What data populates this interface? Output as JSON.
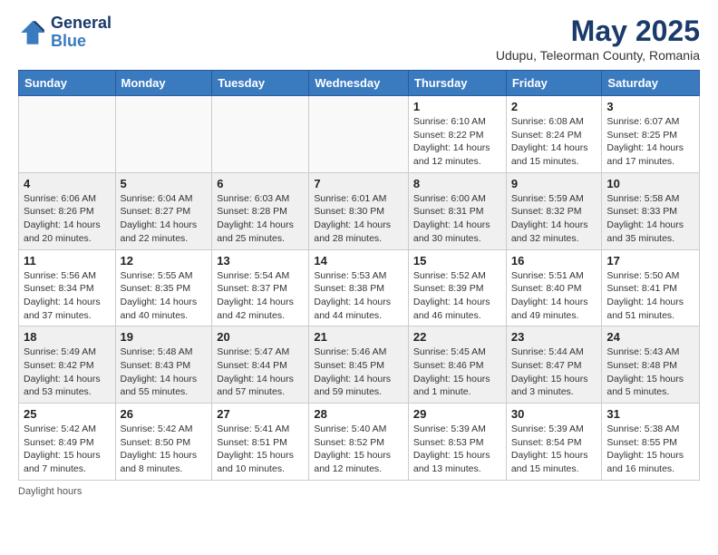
{
  "header": {
    "logo_line1": "General",
    "logo_line2": "Blue",
    "month": "May 2025",
    "location": "Udupu, Teleorman County, Romania"
  },
  "weekdays": [
    "Sunday",
    "Monday",
    "Tuesday",
    "Wednesday",
    "Thursday",
    "Friday",
    "Saturday"
  ],
  "weeks": [
    [
      {
        "day": "",
        "info": ""
      },
      {
        "day": "",
        "info": ""
      },
      {
        "day": "",
        "info": ""
      },
      {
        "day": "",
        "info": ""
      },
      {
        "day": "1",
        "info": "Sunrise: 6:10 AM\nSunset: 8:22 PM\nDaylight: 14 hours\nand 12 minutes."
      },
      {
        "day": "2",
        "info": "Sunrise: 6:08 AM\nSunset: 8:24 PM\nDaylight: 14 hours\nand 15 minutes."
      },
      {
        "day": "3",
        "info": "Sunrise: 6:07 AM\nSunset: 8:25 PM\nDaylight: 14 hours\nand 17 minutes."
      }
    ],
    [
      {
        "day": "4",
        "info": "Sunrise: 6:06 AM\nSunset: 8:26 PM\nDaylight: 14 hours\nand 20 minutes."
      },
      {
        "day": "5",
        "info": "Sunrise: 6:04 AM\nSunset: 8:27 PM\nDaylight: 14 hours\nand 22 minutes."
      },
      {
        "day": "6",
        "info": "Sunrise: 6:03 AM\nSunset: 8:28 PM\nDaylight: 14 hours\nand 25 minutes."
      },
      {
        "day": "7",
        "info": "Sunrise: 6:01 AM\nSunset: 8:30 PM\nDaylight: 14 hours\nand 28 minutes."
      },
      {
        "day": "8",
        "info": "Sunrise: 6:00 AM\nSunset: 8:31 PM\nDaylight: 14 hours\nand 30 minutes."
      },
      {
        "day": "9",
        "info": "Sunrise: 5:59 AM\nSunset: 8:32 PM\nDaylight: 14 hours\nand 32 minutes."
      },
      {
        "day": "10",
        "info": "Sunrise: 5:58 AM\nSunset: 8:33 PM\nDaylight: 14 hours\nand 35 minutes."
      }
    ],
    [
      {
        "day": "11",
        "info": "Sunrise: 5:56 AM\nSunset: 8:34 PM\nDaylight: 14 hours\nand 37 minutes."
      },
      {
        "day": "12",
        "info": "Sunrise: 5:55 AM\nSunset: 8:35 PM\nDaylight: 14 hours\nand 40 minutes."
      },
      {
        "day": "13",
        "info": "Sunrise: 5:54 AM\nSunset: 8:37 PM\nDaylight: 14 hours\nand 42 minutes."
      },
      {
        "day": "14",
        "info": "Sunrise: 5:53 AM\nSunset: 8:38 PM\nDaylight: 14 hours\nand 44 minutes."
      },
      {
        "day": "15",
        "info": "Sunrise: 5:52 AM\nSunset: 8:39 PM\nDaylight: 14 hours\nand 46 minutes."
      },
      {
        "day": "16",
        "info": "Sunrise: 5:51 AM\nSunset: 8:40 PM\nDaylight: 14 hours\nand 49 minutes."
      },
      {
        "day": "17",
        "info": "Sunrise: 5:50 AM\nSunset: 8:41 PM\nDaylight: 14 hours\nand 51 minutes."
      }
    ],
    [
      {
        "day": "18",
        "info": "Sunrise: 5:49 AM\nSunset: 8:42 PM\nDaylight: 14 hours\nand 53 minutes."
      },
      {
        "day": "19",
        "info": "Sunrise: 5:48 AM\nSunset: 8:43 PM\nDaylight: 14 hours\nand 55 minutes."
      },
      {
        "day": "20",
        "info": "Sunrise: 5:47 AM\nSunset: 8:44 PM\nDaylight: 14 hours\nand 57 minutes."
      },
      {
        "day": "21",
        "info": "Sunrise: 5:46 AM\nSunset: 8:45 PM\nDaylight: 14 hours\nand 59 minutes."
      },
      {
        "day": "22",
        "info": "Sunrise: 5:45 AM\nSunset: 8:46 PM\nDaylight: 15 hours\nand 1 minute."
      },
      {
        "day": "23",
        "info": "Sunrise: 5:44 AM\nSunset: 8:47 PM\nDaylight: 15 hours\nand 3 minutes."
      },
      {
        "day": "24",
        "info": "Sunrise: 5:43 AM\nSunset: 8:48 PM\nDaylight: 15 hours\nand 5 minutes."
      }
    ],
    [
      {
        "day": "25",
        "info": "Sunrise: 5:42 AM\nSunset: 8:49 PM\nDaylight: 15 hours\nand 7 minutes."
      },
      {
        "day": "26",
        "info": "Sunrise: 5:42 AM\nSunset: 8:50 PM\nDaylight: 15 hours\nand 8 minutes."
      },
      {
        "day": "27",
        "info": "Sunrise: 5:41 AM\nSunset: 8:51 PM\nDaylight: 15 hours\nand 10 minutes."
      },
      {
        "day": "28",
        "info": "Sunrise: 5:40 AM\nSunset: 8:52 PM\nDaylight: 15 hours\nand 12 minutes."
      },
      {
        "day": "29",
        "info": "Sunrise: 5:39 AM\nSunset: 8:53 PM\nDaylight: 15 hours\nand 13 minutes."
      },
      {
        "day": "30",
        "info": "Sunrise: 5:39 AM\nSunset: 8:54 PM\nDaylight: 15 hours\nand 15 minutes."
      },
      {
        "day": "31",
        "info": "Sunrise: 5:38 AM\nSunset: 8:55 PM\nDaylight: 15 hours\nand 16 minutes."
      }
    ]
  ],
  "footer": {
    "daylight_label": "Daylight hours"
  }
}
